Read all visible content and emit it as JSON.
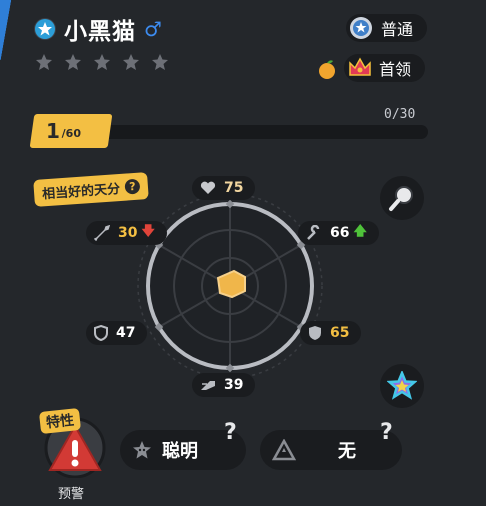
{
  "pal": {
    "name": "小黑猫",
    "gender_icon": "male-icon",
    "rarity_stars": 5,
    "tags": {
      "rarity": "普通",
      "boss": "首领"
    },
    "level": {
      "current": "1",
      "max": "/60"
    },
    "exp": {
      "text": "0/30",
      "fraction": 0
    },
    "talent_label": "相当好的天分"
  },
  "stats": {
    "hp": "75",
    "attack": "30",
    "work": "66",
    "defense_left": "47",
    "defense_right": "65",
    "speed": "39"
  },
  "passives": {
    "section_label": "特性",
    "warning_label": "预警",
    "slot1": "聪明",
    "slot2": "无",
    "help": "?"
  },
  "colors": {
    "background": "#24272b",
    "accent_yellow": "#f3bf43",
    "down_red": "#e0443a",
    "up_green": "#4fc23a"
  }
}
